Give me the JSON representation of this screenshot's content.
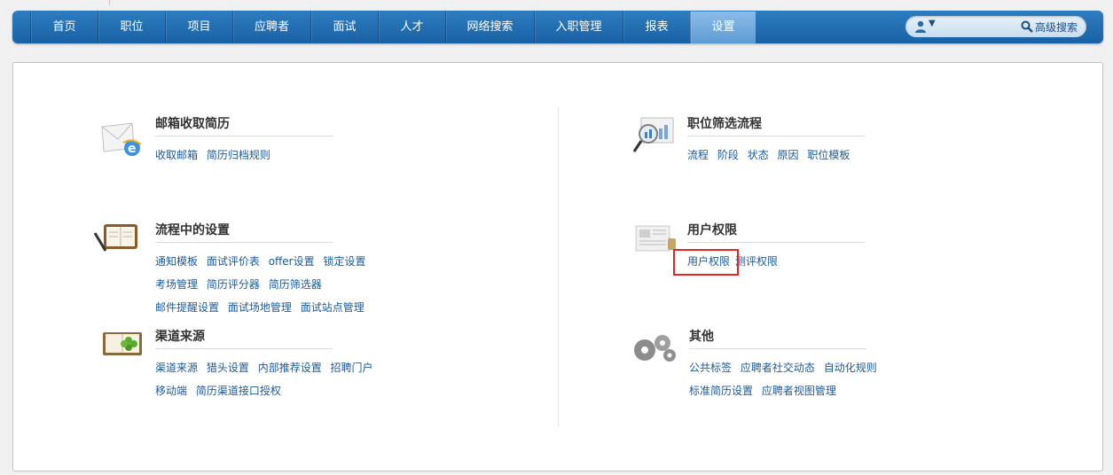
{
  "nav": {
    "items": [
      "首页",
      "职位",
      "项目",
      "应聘者",
      "面试",
      "人才",
      "网络搜索",
      "入职管理",
      "报表",
      "设置"
    ],
    "active_index": 9,
    "search": {
      "user_caret": "▼",
      "advanced_label": "高级搜索"
    }
  },
  "sections": {
    "mail": {
      "title": "邮箱收取简历",
      "links": [
        [
          "收取邮箱",
          "简历归档规则"
        ]
      ]
    },
    "flow": {
      "title": "流程中的设置",
      "links": [
        [
          "通知模板",
          "面试评价表",
          "offer设置",
          "锁定设置"
        ],
        [
          "考场管理",
          "简历评分器",
          "简历筛选器"
        ],
        [
          "邮件提醒设置",
          "面试场地管理",
          "面试站点管理"
        ]
      ]
    },
    "channel": {
      "title": "渠道来源",
      "links": [
        [
          "渠道来源",
          "猎头设置",
          "内部推荐设置",
          "招聘门户"
        ],
        [
          "移动端",
          "简历渠道接口授权"
        ]
      ]
    },
    "position": {
      "title": "职位筛选流程",
      "links": [
        [
          "流程",
          "阶段",
          "状态",
          "原因",
          "职位模板"
        ]
      ]
    },
    "user": {
      "title": "用户权限",
      "links": [
        [
          "用户权限",
          "测评权限"
        ]
      ]
    },
    "other": {
      "title": "其他",
      "links": [
        [
          "公共标签",
          "应聘者社交动态",
          "自动化规则"
        ],
        [
          "标准简历设置",
          "应聘者视图管理"
        ]
      ]
    }
  },
  "colors": {
    "nav_bg": "#1a61a5",
    "link": "#1a5a9a",
    "highlight_box": "#e0262a"
  }
}
